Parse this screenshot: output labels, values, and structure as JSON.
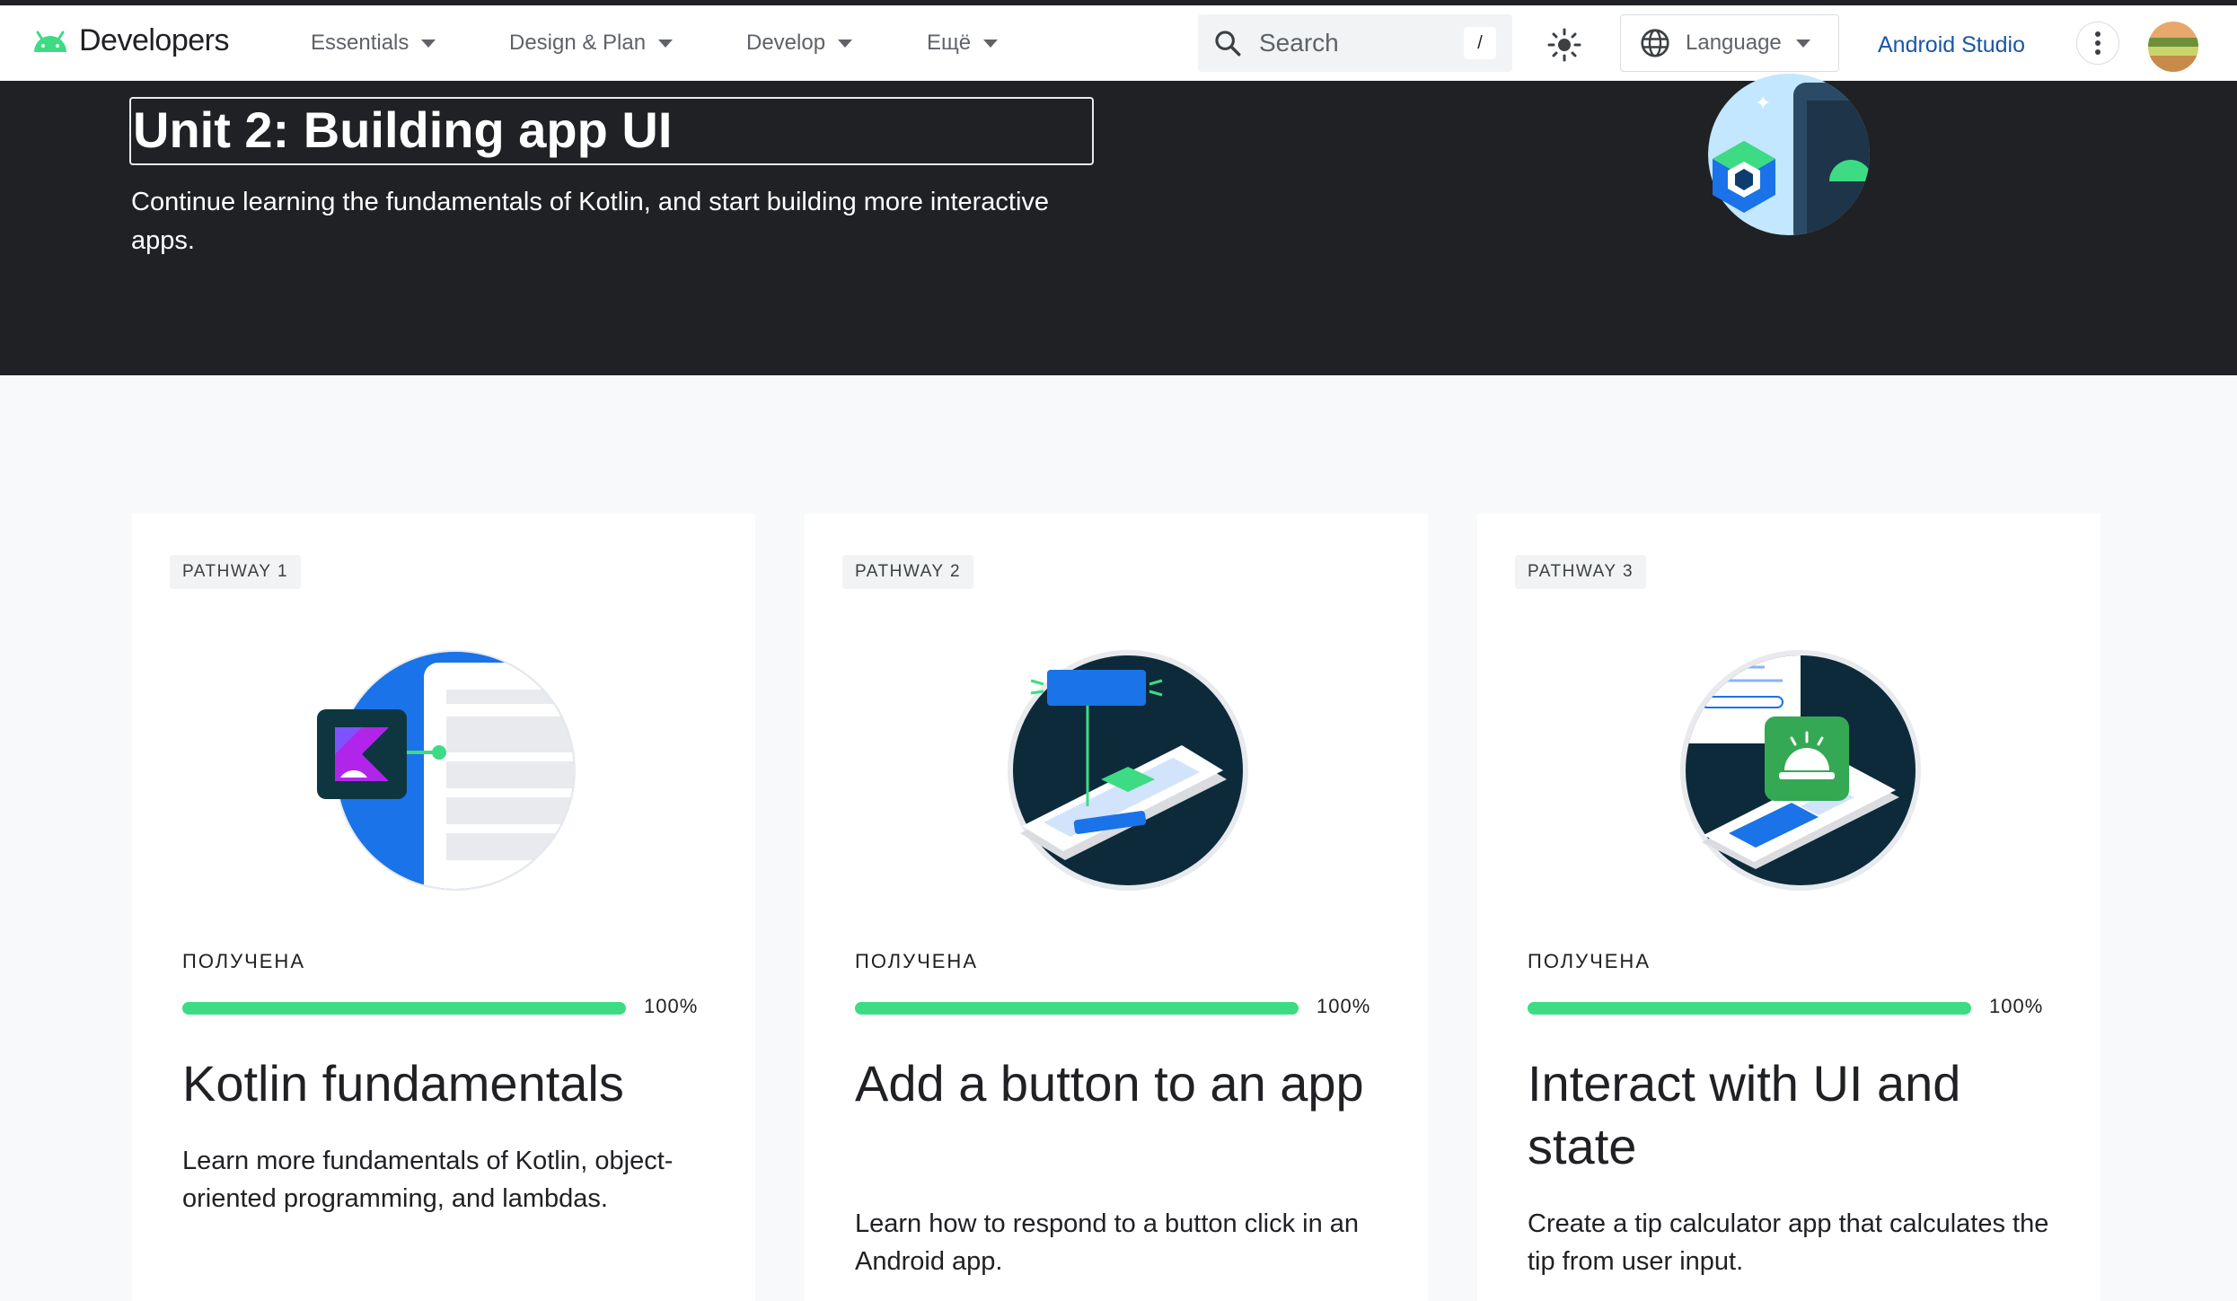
{
  "header": {
    "logo_text": "Developers",
    "nav": [
      {
        "label": "Essentials"
      },
      {
        "label": "Design & Plan"
      },
      {
        "label": "Develop"
      },
      {
        "label": "Ещё"
      }
    ],
    "search_placeholder": "Search",
    "search_shortcut": "/",
    "language_label": "Language",
    "android_studio": "Android Studio"
  },
  "hero": {
    "title": "Unit 2: Building app UI",
    "subtitle": "Continue learning the fundamentals of Kotlin, and start building more interactive apps."
  },
  "cards": [
    {
      "pathway": "PATHWAY 1",
      "status": "ПОЛУЧЕНА",
      "progress": "100%",
      "progress_fraction": 1.0,
      "title": "Kotlin fundamentals",
      "description": "Learn more fundamentals of Kotlin, object-oriented programming, and lambdas."
    },
    {
      "pathway": "PATHWAY 2",
      "status": "ПОЛУЧЕНА",
      "progress": "100%",
      "progress_fraction": 1.0,
      "title": "Add a button to an app",
      "description": "Learn how to respond to a button click in an Android app."
    },
    {
      "pathway": "PATHWAY 3",
      "status": "ПОЛУЧЕНА",
      "progress": "100%",
      "progress_fraction": 1.0,
      "title": "Interact with UI and state",
      "description": "Create a tip calculator app that calculates the tip from user input."
    }
  ],
  "colors": {
    "accent_green": "#3ddc84",
    "link_blue": "#1a56a8",
    "hero_bg": "#202124"
  }
}
